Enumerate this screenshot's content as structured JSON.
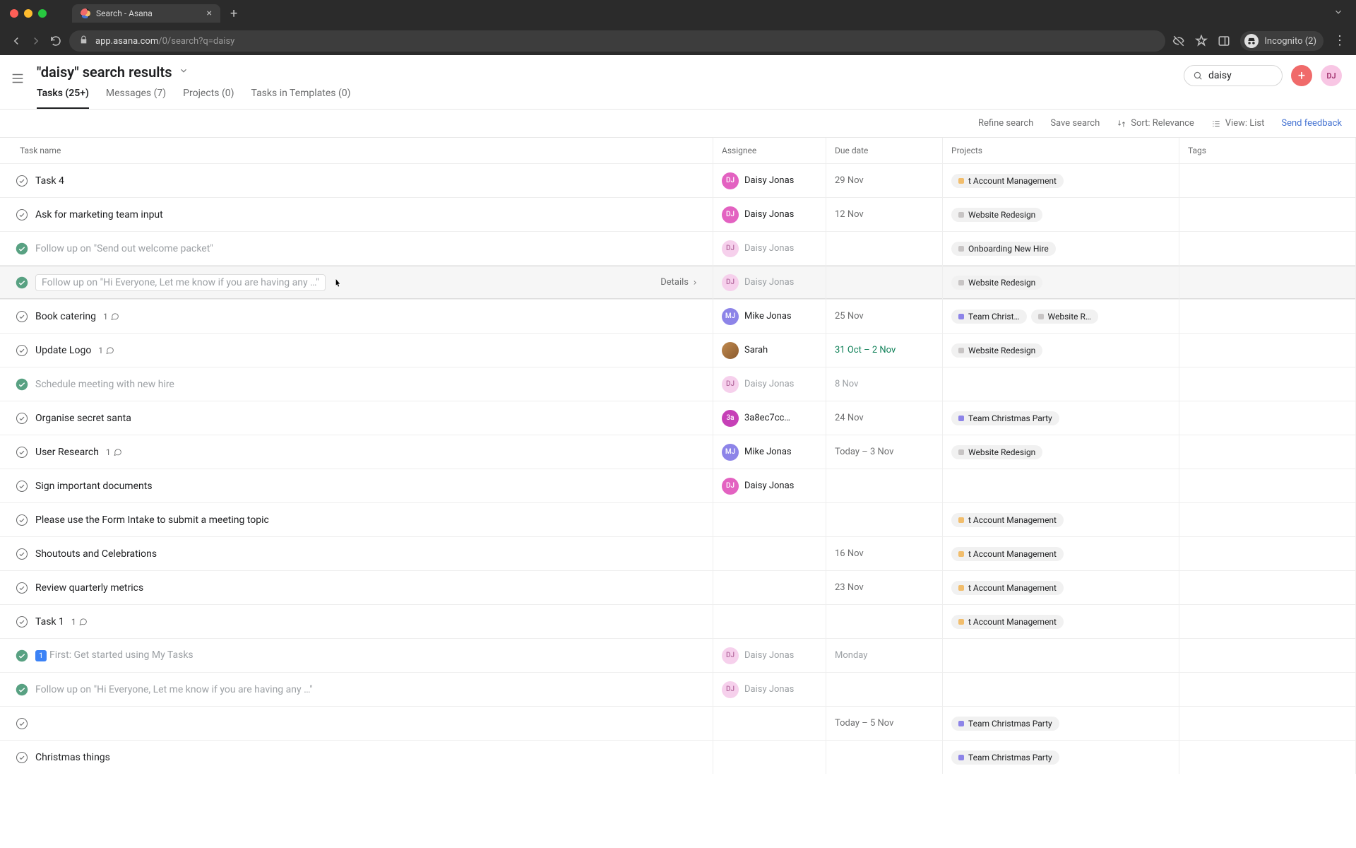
{
  "browser": {
    "tab_title": "Search - Asana",
    "url_host": "app.asana.com",
    "url_path": "/0/search?q=daisy",
    "incognito_label": "Incognito (2)"
  },
  "header": {
    "title": "\"daisy\" search results",
    "tabs": [
      {
        "label": "Tasks (25+)",
        "active": true
      },
      {
        "label": "Messages (7)",
        "active": false
      },
      {
        "label": "Projects (0)",
        "active": false
      },
      {
        "label": "Tasks in Templates (0)",
        "active": false
      }
    ],
    "search_value": "daisy",
    "avatar_initials": "DJ"
  },
  "toolbar": {
    "refine": "Refine search",
    "save": "Save search",
    "sort": "Sort: Relevance",
    "view": "View: List",
    "feedback": "Send feedback"
  },
  "columns": {
    "name": "Task name",
    "assignee": "Assignee",
    "due": "Due date",
    "projects": "Projects",
    "tags": "Tags"
  },
  "details_label": "Details",
  "rows": [
    {
      "name": "Task 4",
      "completed": false,
      "assignee": {
        "label": "Daisy Jonas",
        "avatar": "dj"
      },
      "due": "29 Nov",
      "projects": [
        {
          "label": "t Account Management",
          "color": "orange"
        }
      ]
    },
    {
      "name": "Ask for marketing team input",
      "completed": false,
      "assignee": {
        "label": "Daisy Jonas",
        "avatar": "dj"
      },
      "due": "12 Nov",
      "projects": [
        {
          "label": "Website Redesign",
          "color": "gray"
        }
      ]
    },
    {
      "name": "Follow up on \"Send out welcome packet\"",
      "completed": true,
      "assignee": {
        "label": "Daisy Jonas",
        "avatar": "dj-muted"
      },
      "due": "",
      "projects": [
        {
          "label": "Onboarding New Hire",
          "color": "gray"
        }
      ]
    },
    {
      "name": "Follow up on \"Hi Everyone, Let me know if you are having any …\"",
      "completed": true,
      "hovered": true,
      "boxed": true,
      "assignee": {
        "label": "Daisy Jonas",
        "avatar": "dj-muted"
      },
      "due": "",
      "projects": [
        {
          "label": "Website Redesign",
          "color": "gray"
        }
      ]
    },
    {
      "name": "Book catering",
      "completed": false,
      "comments": "1",
      "assignee": {
        "label": "Mike Jonas",
        "avatar": "mj"
      },
      "due": "25 Nov",
      "projects": [
        {
          "label": "Team Christ…",
          "color": "purple"
        },
        {
          "label": "Website R…",
          "color": "gray"
        }
      ]
    },
    {
      "name": "Update Logo",
      "completed": false,
      "comments": "1",
      "assignee": {
        "label": "Sarah",
        "avatar": "sarah"
      },
      "due": "31 Oct – 2 Nov",
      "due_color": "green",
      "projects": [
        {
          "label": "Website Redesign",
          "color": "gray"
        }
      ]
    },
    {
      "name": "Schedule meeting with new hire",
      "completed": true,
      "assignee": {
        "label": "Daisy Jonas",
        "avatar": "dj-muted"
      },
      "due": "8 Nov",
      "due_muted": true,
      "projects": []
    },
    {
      "name": "Organise secret santa",
      "completed": false,
      "assignee": {
        "label": "3a8ec7cc…",
        "avatar": "3a"
      },
      "due": "24 Nov",
      "projects": [
        {
          "label": "Team Christmas Party",
          "color": "purple"
        }
      ]
    },
    {
      "name": "User Research",
      "completed": false,
      "comments": "1",
      "assignee": {
        "label": "Mike Jonas",
        "avatar": "mj"
      },
      "due": "Today – 3 Nov",
      "projects": [
        {
          "label": "Website Redesign",
          "color": "gray"
        }
      ]
    },
    {
      "name": "Sign important documents",
      "completed": false,
      "assignee": {
        "label": "Daisy Jonas",
        "avatar": "dj"
      },
      "due": "",
      "projects": []
    },
    {
      "name": "Please use the Form Intake to submit a meeting topic",
      "completed": false,
      "assignee": null,
      "due": "",
      "projects": [
        {
          "label": "t Account Management",
          "color": "orange"
        }
      ]
    },
    {
      "name": "Shoutouts and Celebrations",
      "completed": false,
      "assignee": null,
      "due": "16 Nov",
      "projects": [
        {
          "label": "t Account Management",
          "color": "orange"
        }
      ]
    },
    {
      "name": "Review quarterly metrics",
      "completed": false,
      "assignee": null,
      "due": "23 Nov",
      "projects": [
        {
          "label": "t Account Management",
          "color": "orange"
        }
      ]
    },
    {
      "name": "Task 1",
      "completed": false,
      "comments": "1",
      "assignee": null,
      "due": "",
      "projects": [
        {
          "label": "t Account Management",
          "color": "orange"
        }
      ]
    },
    {
      "name": "First: Get started using My Tasks",
      "completed": true,
      "emoji_prefix": true,
      "assignee": {
        "label": "Daisy Jonas",
        "avatar": "dj-muted"
      },
      "due": "Monday",
      "due_muted": true,
      "projects": []
    },
    {
      "name": "Follow up on \"Hi Everyone, Let me know if you are having any …\"",
      "completed": true,
      "assignee": {
        "label": "Daisy Jonas",
        "avatar": "dj-muted"
      },
      "due": "",
      "projects": []
    },
    {
      "name": "",
      "completed": false,
      "assignee": null,
      "due": "Today – 5 Nov",
      "projects": [
        {
          "label": "Team Christmas Party",
          "color": "purple"
        }
      ]
    },
    {
      "name": "Christmas things",
      "completed": false,
      "assignee": null,
      "due": "",
      "projects": [
        {
          "label": "Team Christmas Party",
          "color": "purple"
        }
      ]
    }
  ]
}
